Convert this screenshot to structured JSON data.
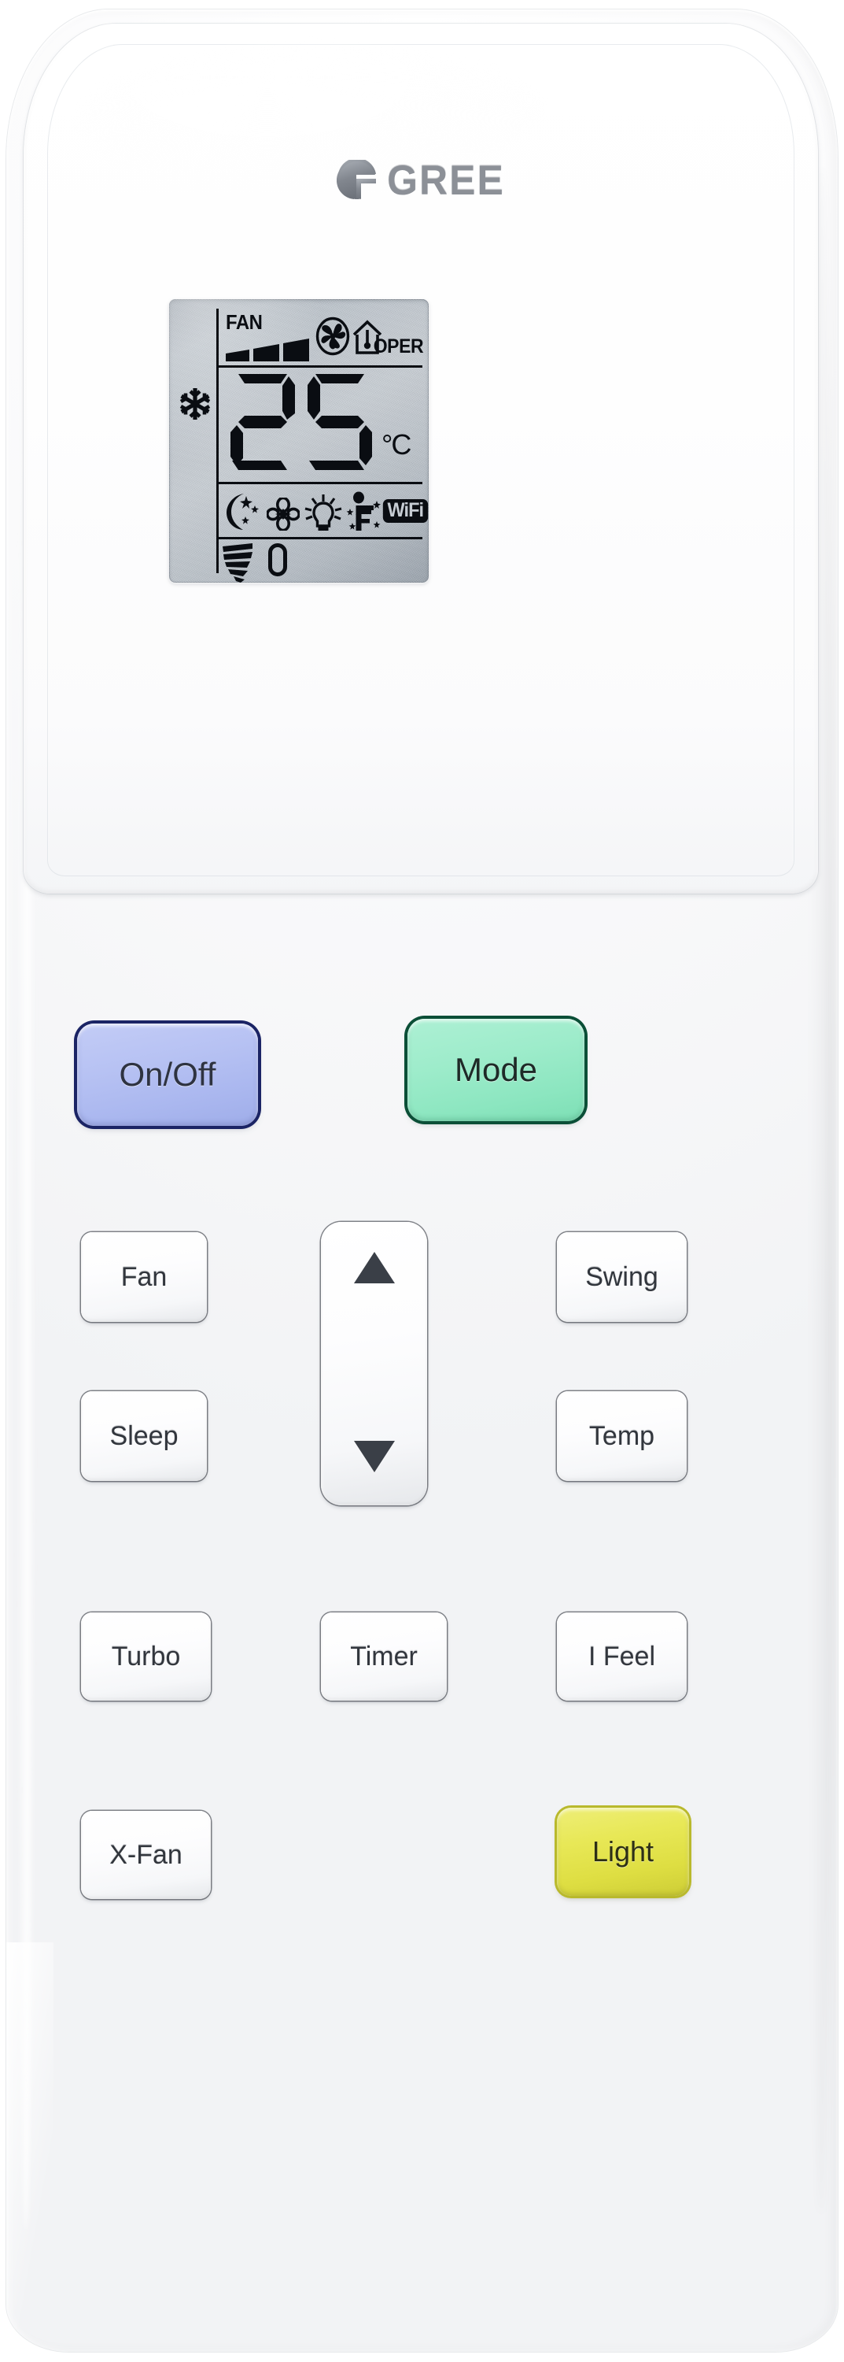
{
  "device": {
    "brand": "GREE",
    "type": "air-conditioner-remote-control"
  },
  "display": {
    "fan_label": "FAN",
    "fan_speed_bars": 3,
    "fan_speed_bars_total": 3,
    "oper_label": "OPER",
    "temperature": "25",
    "temperature_unit": "°C",
    "mode_icon": "snowflake-icon",
    "mode_name": "cool",
    "turbo_icon": "turbo-fan-icon",
    "ifeel_house_icon": "house-thermometer-icon",
    "status_icons": [
      {
        "name": "moon-stars-icon",
        "label": "sleep"
      },
      {
        "name": "x-fan-clover-icon",
        "label": "x-fan"
      },
      {
        "name": "lightbulb-icon",
        "label": "light"
      },
      {
        "name": "i-feel-person-icon",
        "label": "i-feel"
      }
    ],
    "wifi_badge": "WiFi",
    "swing_icon": "swing-blades-icon",
    "swing_position": "0"
  },
  "buttons": {
    "power": {
      "label": "On/Off",
      "color": "#b7c2f3",
      "border_color": "#1b2465"
    },
    "mode": {
      "label": "Mode",
      "color": "#9eeccb",
      "border_color": "#0b4f37"
    },
    "fan": {
      "label": "Fan",
      "color": "#fdfdfe"
    },
    "sleep": {
      "label": "Sleep",
      "color": "#fdfdfe"
    },
    "swing": {
      "label": "Swing",
      "color": "#fdfdfe"
    },
    "temp": {
      "label": "Temp",
      "color": "#fdfdfe"
    },
    "turbo": {
      "label": "Turbo",
      "color": "#fdfdfe"
    },
    "timer": {
      "label": "Timer",
      "color": "#fdfdfe"
    },
    "ifeel": {
      "label": "I Feel",
      "color": "#fdfdfe"
    },
    "xfan": {
      "label": "X-Fan",
      "color": "#fdfdfe"
    },
    "light": {
      "label": "Light",
      "color": "#e8e857",
      "border_color": "#b9b92c"
    },
    "up": {
      "label": "",
      "icon": "triangle-up-icon"
    },
    "down": {
      "label": "",
      "icon": "triangle-down-icon"
    }
  },
  "colors": {
    "body": "#fbfbfc",
    "lcd_background": "#c2c9d0",
    "lcd_foreground": "#0a0d12",
    "accent_power": "#b7c2f3",
    "accent_mode": "#9eeccb",
    "accent_light": "#e8e857"
  }
}
